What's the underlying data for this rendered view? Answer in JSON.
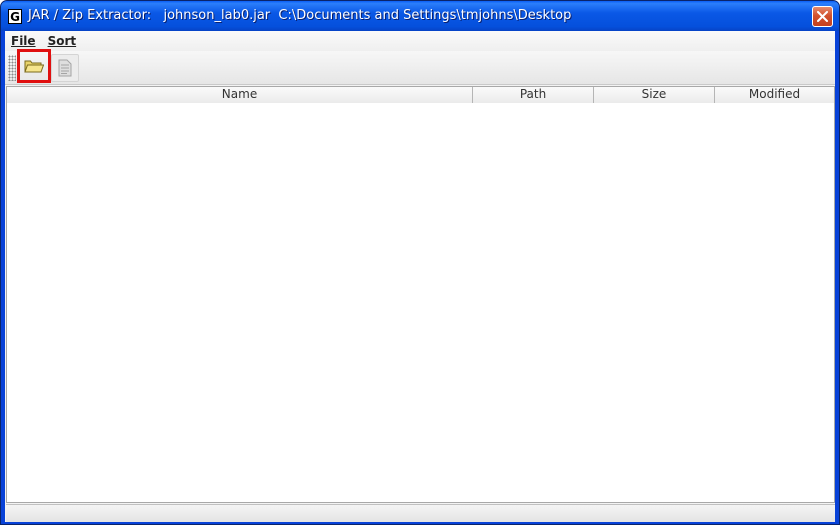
{
  "window": {
    "title": "JAR / Zip Extractor:   johnson_lab0.jar  C:\\Documents and Settings\\tmjohns\\Desktop",
    "app_icon_letter": "G"
  },
  "menubar": {
    "items": [
      {
        "label": "File"
      },
      {
        "label": "Sort"
      }
    ]
  },
  "toolbar": {
    "buttons": [
      {
        "icon": "folder-open-icon",
        "enabled": true,
        "highlighted": true
      },
      {
        "icon": "document-extract-icon",
        "enabled": false
      }
    ]
  },
  "table": {
    "columns": [
      "Name",
      "Path",
      "Size",
      "Modified"
    ],
    "rows": []
  },
  "colors": {
    "titlebar": "#0a58e6",
    "highlight": "#e01010"
  }
}
